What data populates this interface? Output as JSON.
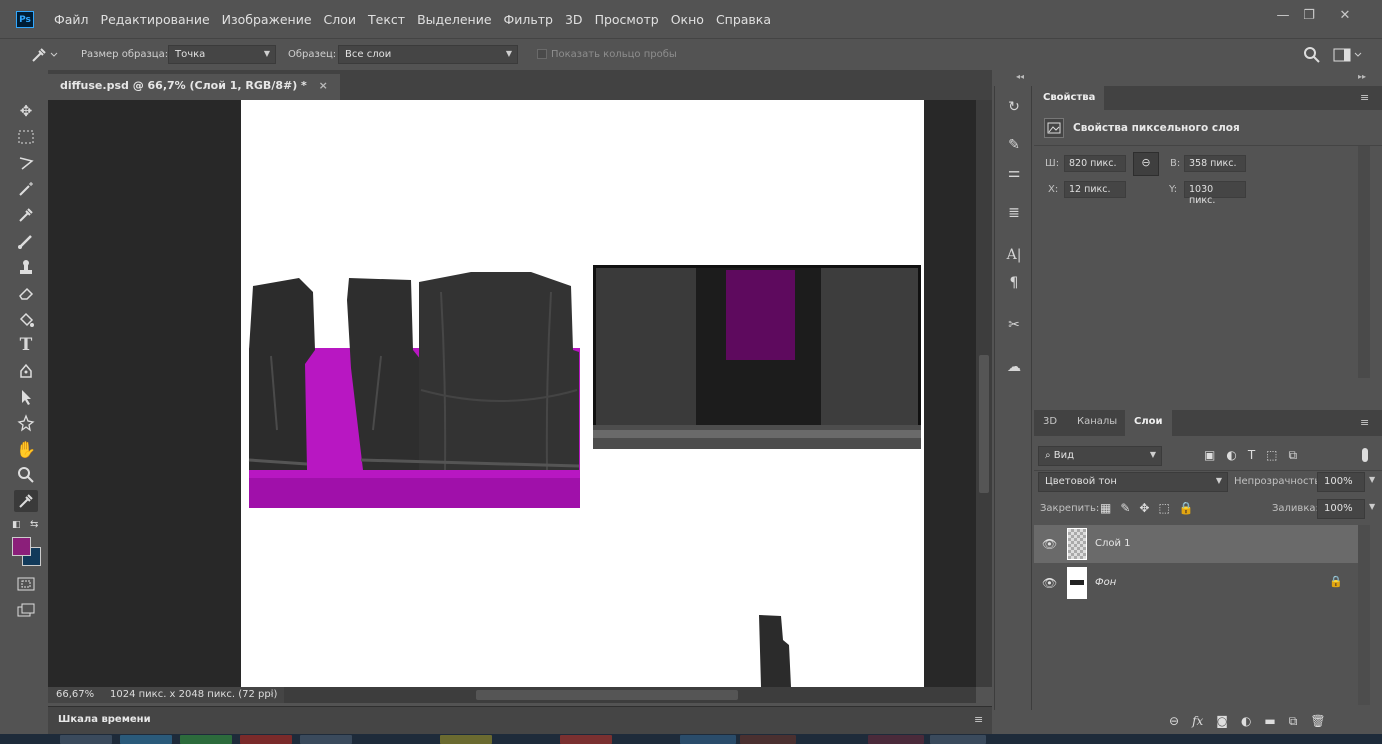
{
  "app": {
    "logo_text": "Ps"
  },
  "menu": [
    "Файл",
    "Редактирование",
    "Изображение",
    "Слои",
    "Текст",
    "Выделение",
    "Фильтр",
    "3D",
    "Просмотр",
    "Окно",
    "Справка"
  ],
  "window_controls": {
    "minimize": "—",
    "restore": "❐",
    "close": "✕"
  },
  "options_bar": {
    "sample_size_label": "Размер образца:",
    "sample_size_value": "Точка",
    "sample_label": "Образец:",
    "sample_value": "Все слои",
    "show_ring_label": "Показать кольцо пробы"
  },
  "document": {
    "tab_title": "diffuse.psd @ 66,7% (Слой 1, RGB/8#) *",
    "close_glyph": "×",
    "zoom": "66,67%",
    "info": "1024 пикс. x 2048 пикс. (72 ppi)"
  },
  "colors": {
    "foreground": "#8b1f7a",
    "background": "#123a5a",
    "canvas": "#282828",
    "panel": "#535353"
  },
  "timeline": {
    "label": "Шкала времени"
  },
  "properties": {
    "tab": "Свойства",
    "header": "Свойства пиксельного слоя",
    "w_label": "Ш:",
    "w_value": "820 пикс.",
    "h_label": "В:",
    "h_value": "358 пикс.",
    "x_label": "X:",
    "x_value": "12 пикс.",
    "y_label": "Y:",
    "y_value": "1030 пикс."
  },
  "layers_panel": {
    "tabs": [
      "3D",
      "Каналы",
      "Слои"
    ],
    "filter_value": "Вид",
    "blend_mode": "Цветовой тон",
    "opacity_label": "Непрозрачность:",
    "opacity_value": "100%",
    "lock_label": "Закрепить:",
    "fill_label": "Заливка:",
    "fill_value": "100%",
    "layers": [
      {
        "name": "Слой 1",
        "selected": true
      },
      {
        "name": "Фон",
        "selected": false,
        "locked": true
      }
    ]
  },
  "icons": {
    "eyedropper": "eyedropper-icon",
    "move": "move-icon",
    "marquee": "marquee-icon",
    "lasso": "lasso-icon",
    "magic": "magic-wand-icon",
    "brush": "brush-icon",
    "stamp": "stamp-icon",
    "eraser": "eraser-icon",
    "fill": "fill-icon",
    "text": "text-icon",
    "pen": "pen-icon",
    "select": "path-select-icon",
    "shape": "shape-icon",
    "hand": "hand-icon",
    "zoom": "zoom-icon",
    "search": "search-icon"
  }
}
